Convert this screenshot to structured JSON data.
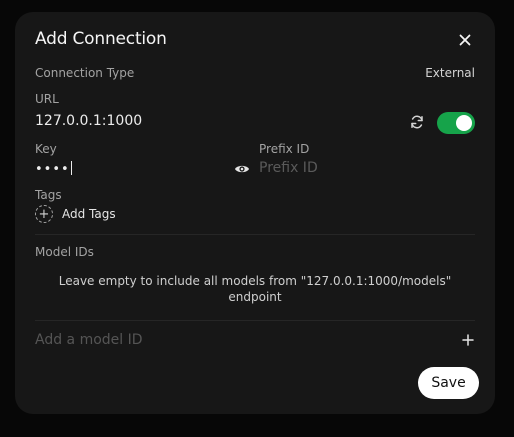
{
  "dialog": {
    "title": "Add Connection",
    "connection_type_label": "Connection Type",
    "connection_type_value": "External",
    "url_label": "URL",
    "url_value": "127.0.0.1:1000",
    "url_enabled": true,
    "key_label": "Key",
    "key_value": "••••",
    "prefix_label": "Prefix ID",
    "prefix_placeholder": "Prefix ID",
    "tags_label": "Tags",
    "add_tags_label": "Add Tags",
    "model_ids_label": "Model IDs",
    "model_ids_help": "Leave empty to include all models from \"127.0.0.1:1000/models\" endpoint",
    "model_input_placeholder": "Add a model ID",
    "save_label": "Save"
  },
  "colors": {
    "backdrop": "#070707",
    "panel": "#171717",
    "toggle_on": "#16a34a",
    "save_bg": "#ffffff"
  },
  "icons": [
    "close-icon",
    "refresh-icon",
    "toggle-switch",
    "eye-icon",
    "plus-circle-icon",
    "plus-icon"
  ]
}
